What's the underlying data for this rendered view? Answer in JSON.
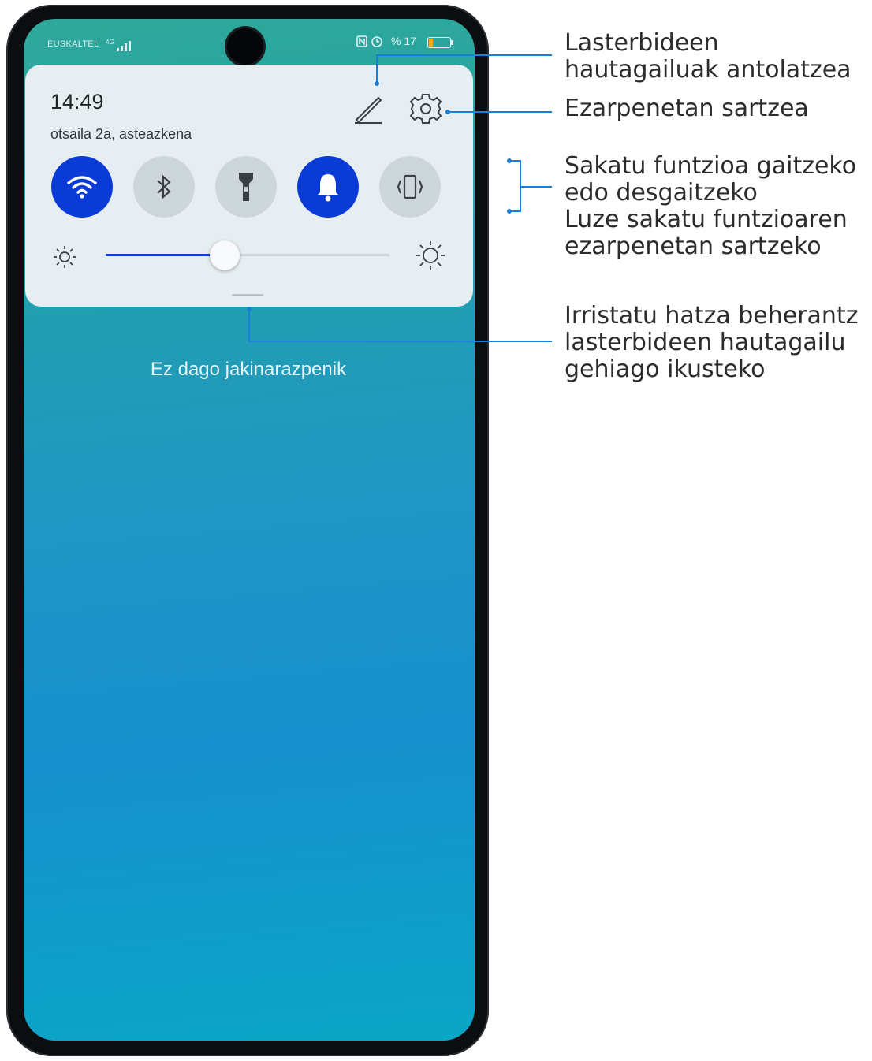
{
  "status_bar": {
    "carrier": "EUSKALTEL",
    "network": "4G",
    "right_text": "% 17",
    "battery_percent": 17
  },
  "panel": {
    "time": "14:49",
    "date": "otsaila 2a, asteazkena",
    "toggles": [
      {
        "name": "wifi",
        "state": "on"
      },
      {
        "name": "bluetooth",
        "state": "off"
      },
      {
        "name": "flashlight",
        "state": "off"
      },
      {
        "name": "sound",
        "state": "on"
      },
      {
        "name": "vibrate",
        "state": "off"
      }
    ],
    "brightness_fraction": 0.42
  },
  "notifications": {
    "empty_text": "Ez dago jakinarazpenik"
  },
  "callouts": {
    "edit_line1": "Lasterbideen",
    "edit_line2": "hautagailuak antolatzea",
    "settings": "Ezarpenetan sartzea",
    "toggle_line1": "Sakatu funtzioa gaitzeko",
    "toggle_line2": "edo desgaitzeko",
    "toggle_line3": "Luze sakatu funtzioaren",
    "toggle_line4": "ezarpenetan sartzeko",
    "swipe_line1": "Irristatu hatza beherantz",
    "swipe_line2": "lasterbideen hautagailu",
    "swipe_line3": "gehiago ikusteko"
  },
  "colors": {
    "accent": "#0a3bd7",
    "callout_line": "#1a7fd4"
  }
}
